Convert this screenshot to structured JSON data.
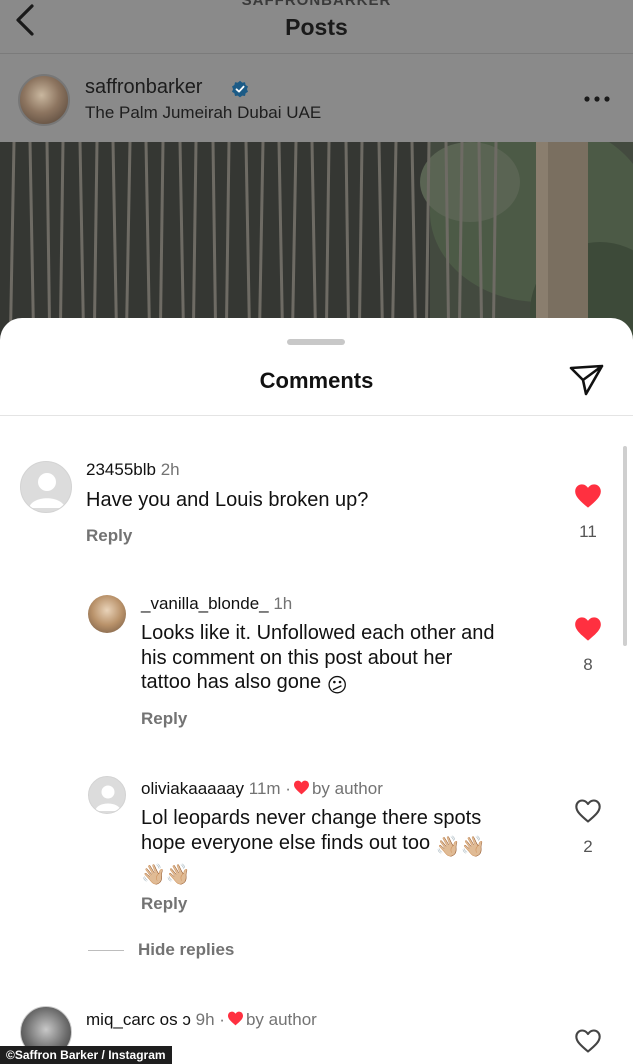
{
  "header": {
    "account_label": "SAFFRONBARKER",
    "title": "Posts"
  },
  "post": {
    "username": "saffronbarker",
    "location": "The Palm Jumeirah Dubai UAE"
  },
  "sheet": {
    "title": "Comments"
  },
  "comments": [
    {
      "username": "23455blb",
      "time": "2h",
      "text": "Have you and Louis broken up?",
      "reply_label": "Reply",
      "likes": "11",
      "liked": true
    },
    {
      "username": "_vanilla_blonde_",
      "time": "1h",
      "text_lines": [
        "Looks like it. Unfollowed each other and",
        "his comment on this post about her",
        "tattoo has also gone"
      ],
      "emoji": "😕",
      "reply_label": "Reply",
      "likes": "8",
      "liked": true
    },
    {
      "username": "oliviakaaaaay",
      "time": "11m",
      "author_badge": "by author",
      "text_lines": [
        "Lol leopards never change there spots",
        "hope everyone else finds out too"
      ],
      "emoji": "👋🏼",
      "reply_label": "Reply",
      "likes": "2",
      "liked": false
    },
    {
      "username": "miq_carc os ɔ",
      "time": "9h",
      "author_badge": "by author",
      "liked": false
    }
  ],
  "hide_replies_label": "Hide replies",
  "watermark": "©Saffron Barker / Instagram",
  "colors": {
    "like_red": "#ff3040",
    "secondary_text": "#737373",
    "dim_overlay": "#8a8a8a",
    "verified_blue": "#0095f6"
  },
  "icons": [
    "back-arrow-icon",
    "verified-badge-icon",
    "more-options-icon",
    "send-icon",
    "heart-icon"
  ]
}
